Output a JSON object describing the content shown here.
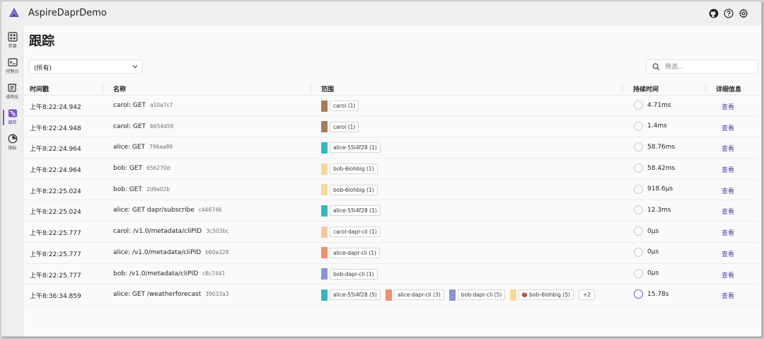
{
  "app": {
    "title": "AspireDaprDemo"
  },
  "sidebar": {
    "items": [
      {
        "label": "资源",
        "icon": "resources-icon",
        "active": false
      },
      {
        "label": "控制台",
        "icon": "console-icon",
        "active": false
      },
      {
        "label": "结构化",
        "icon": "structured-icon",
        "active": false
      },
      {
        "label": "跟踪",
        "icon": "traces-icon",
        "active": true
      },
      {
        "label": "指标",
        "icon": "metrics-icon",
        "active": false
      }
    ]
  },
  "page": {
    "title": "跟踪"
  },
  "filter": {
    "selected": "(所有)"
  },
  "search": {
    "placeholder": "筛选..."
  },
  "table": {
    "headers": {
      "timestamp": "时间戳",
      "name": "名称",
      "scope": "范围",
      "duration": "持续时间",
      "details": "详细信息"
    },
    "view_label": "查看",
    "rows": [
      {
        "time": "上午8:22:24.942",
        "name": "carol: GET",
        "id": "a10a7c7",
        "scopes": [
          {
            "label": "carol (1)",
            "color": "#a97c5a"
          }
        ],
        "duration": "4.71ms"
      },
      {
        "time": "上午8:22:24.948",
        "name": "carol: GET",
        "id": "6654d59",
        "scopes": [
          {
            "label": "carol (1)",
            "color": "#a97c5a"
          }
        ],
        "duration": "1.4ms"
      },
      {
        "time": "上午8:22:24.964",
        "name": "alice: GET",
        "id": "796aa89",
        "scopes": [
          {
            "label": "alice-55i4f28 (1)",
            "color": "#35b7bd"
          }
        ],
        "duration": "58.76ms"
      },
      {
        "time": "上午8:22:24.964",
        "name": "bob: GET",
        "id": "656270d",
        "scopes": [
          {
            "label": "bob-6lohbig (1)",
            "color": "#f5d99a"
          }
        ],
        "duration": "58.42ms"
      },
      {
        "time": "上午8:22:25.024",
        "name": "bob: GET",
        "id": "2d9a02b",
        "scopes": [
          {
            "label": "bob-6lohbig (1)",
            "color": "#f5d99a"
          }
        ],
        "duration": "918.6μs"
      },
      {
        "time": "上午8:22:25.024",
        "name": "alice: GET dapr/subscribe",
        "id": "c446746",
        "scopes": [
          {
            "label": "alice-55i4f28 (1)",
            "color": "#35b7bd"
          }
        ],
        "duration": "12.3ms"
      },
      {
        "time": "上午8:22:25.777",
        "name": "carol: /v1.0/metadata/cliPID",
        "id": "3c503bc",
        "scopes": [
          {
            "label": "carol-dapr-cli (1)",
            "color": "#f5c99a"
          }
        ],
        "duration": "0μs"
      },
      {
        "time": "上午8:22:25.777",
        "name": "alice: /v1.0/metadata/cliPID",
        "id": "b60a328",
        "scopes": [
          {
            "label": "alice-dapr-cli (1)",
            "color": "#ef8f6e"
          }
        ],
        "duration": "0μs"
      },
      {
        "time": "上午8:22:25.777",
        "name": "bob: /v1.0/metadata/cliPID",
        "id": "c8c7441",
        "scopes": [
          {
            "label": "bob-dapr-cli (1)",
            "color": "#8a93d6"
          }
        ],
        "duration": "0μs"
      },
      {
        "time": "上午8:36:34.859",
        "name": "alice: GET /weatherforecast",
        "id": "39033a3",
        "scopes": [
          {
            "label": "alice-55i4f28 (5)",
            "color": "#35b7bd"
          },
          {
            "label": "alice-dapr-cli (3)",
            "color": "#ef8f6e"
          },
          {
            "label": "bob-dapr-cli (5)",
            "color": "#8a93d6"
          },
          {
            "label": "bob-6lohbig (5)",
            "color": "#f5d99a",
            "error": true
          }
        ],
        "more": "+2",
        "duration": "15.78s",
        "busy": true
      }
    ]
  },
  "colors": {
    "accent": "#5b3fb0",
    "active_bar": "#7a4fd1"
  }
}
